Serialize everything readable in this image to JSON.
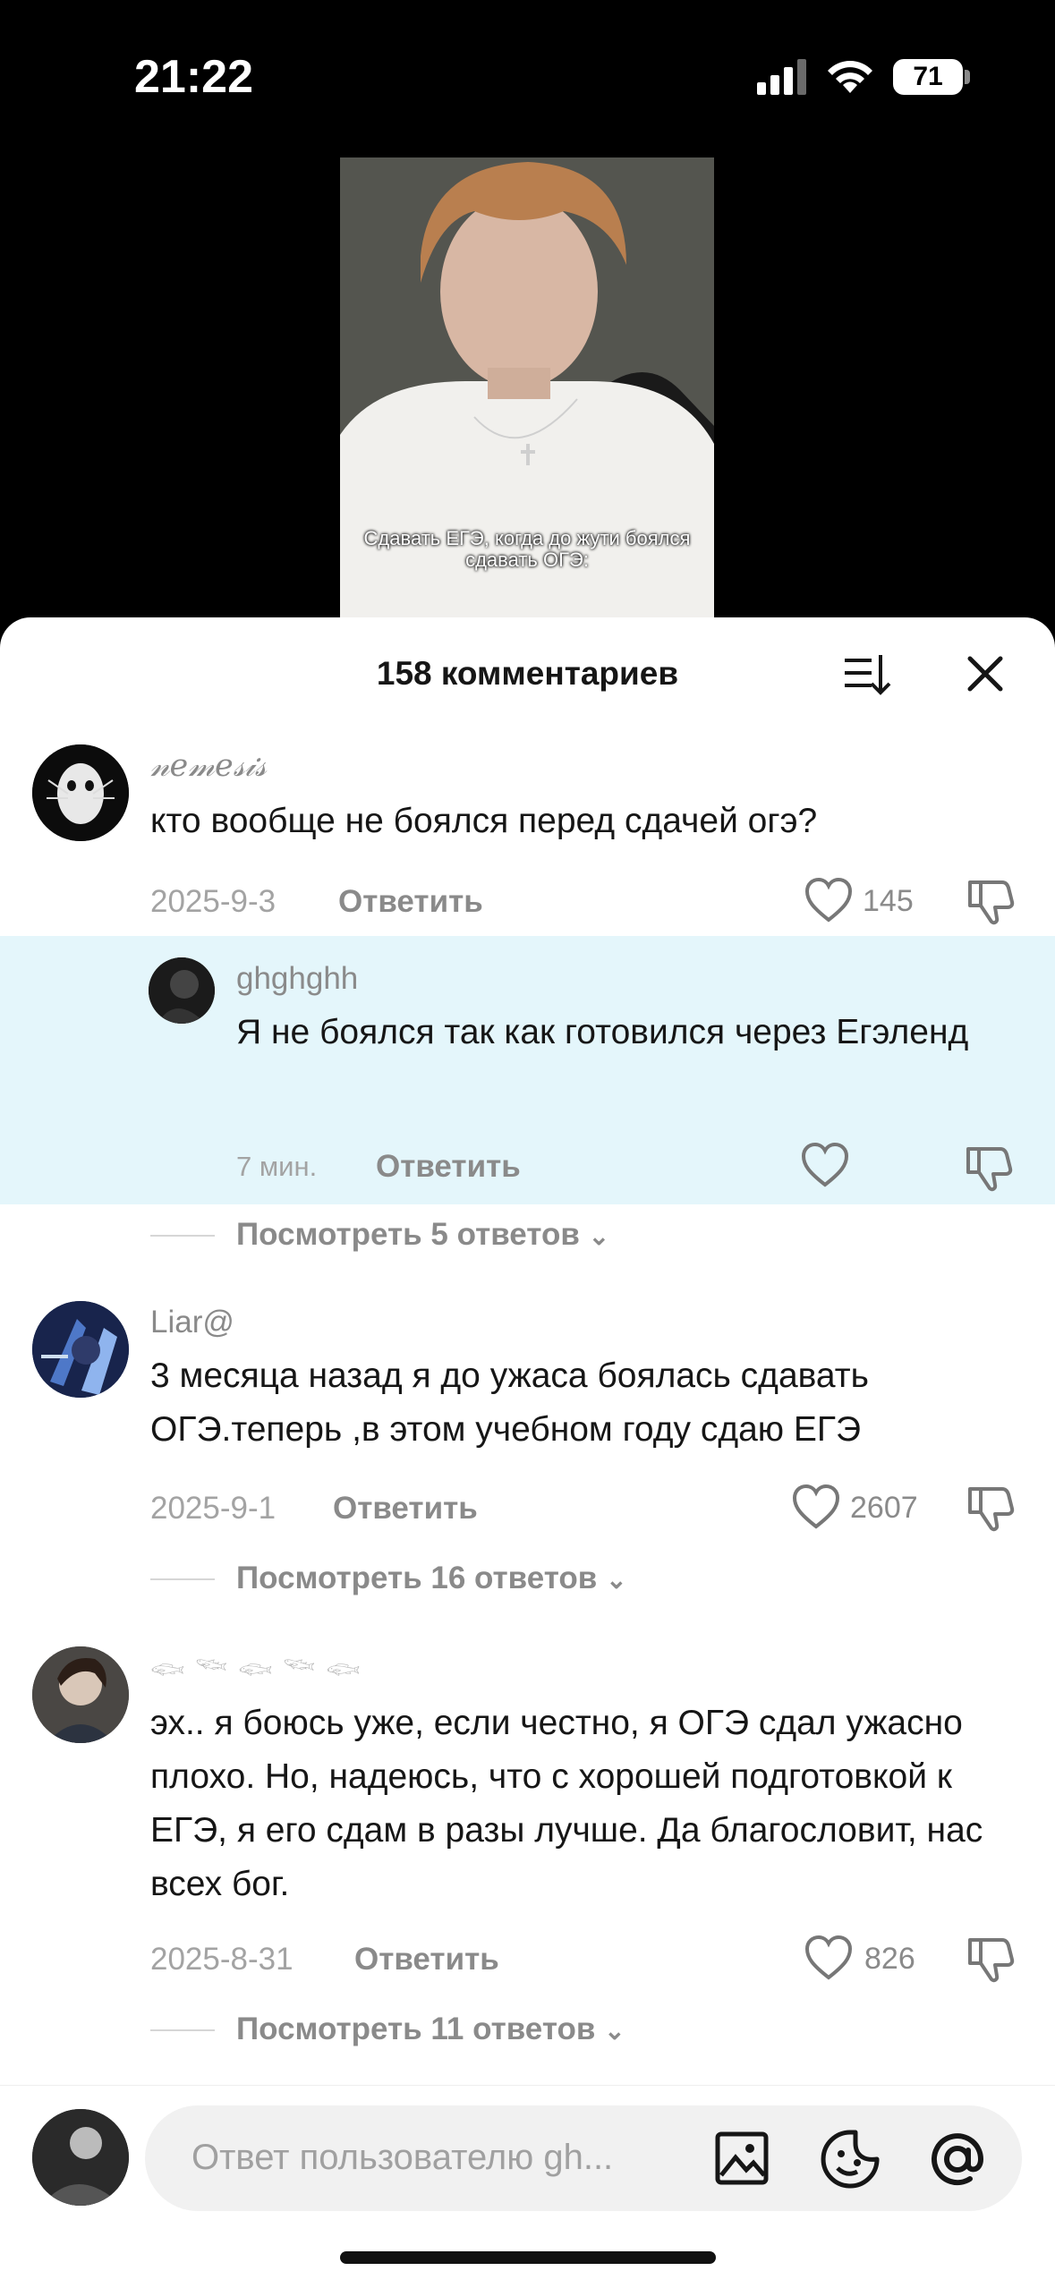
{
  "status_bar": {
    "time": "21:22",
    "battery": "71"
  },
  "video": {
    "caption": "Сдавать ЕГЭ, когда до жути боялся сдавать ОГЭ:"
  },
  "comments_header": {
    "title": "158 комментариев"
  },
  "comments": [
    {
      "user": "𝓃𝑒𝓂𝑒𝓈𝒾𝓈",
      "text": "кто вообще не боялся перед сдачей огэ?",
      "date": "2025-9-3",
      "reply_label": "Ответить",
      "likes": "145"
    },
    {
      "user": "Liar@",
      "text": "3 месяца назад я до ужаса боялась сдавать ОГЭ.теперь ,в этом учебном году сдаю ЕГЭ",
      "date": "2025-9-1",
      "reply_label": "Ответить",
      "likes": "2607",
      "view_replies": "Посмотреть 16 ответов"
    },
    {
      "user": "𓆟 𓆝 𓆟 𓆝 𓆟",
      "text": "эх.. я боюсь уже, если честно, я ОГЭ сдал ужасно плохо. Но, надеюсь, что с хорошей подготовкой к ЕГЭ, я его сдам в разы лучше. Да благословит, нас всех бог.",
      "date": "2025-8-31",
      "reply_label": "Ответить",
      "likes": "826",
      "view_replies": "Посмотреть 11 ответов"
    }
  ],
  "reply_thread": {
    "user": "ghghghh",
    "text": "Я не боялся так как готовился через Егэленд",
    "date": "7 мин.",
    "reply_label": "Ответить",
    "view_replies": "Посмотреть 5 ответов"
  },
  "composer": {
    "placeholder": "Ответ пользователю gh..."
  },
  "colors": {
    "highlight": "#e4f6fb",
    "text": "#161616",
    "muted": "#8a8a8a"
  }
}
